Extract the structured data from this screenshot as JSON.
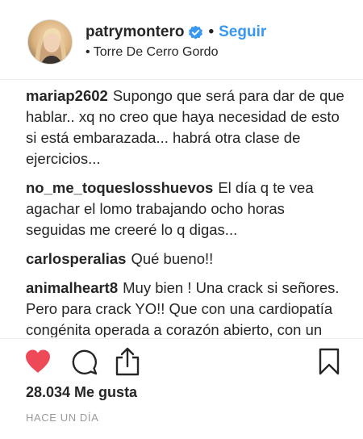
{
  "post": {
    "username": "patrymontero",
    "separator": "•",
    "follow_label": "Seguir",
    "location": "• Torre De Cerro Gordo",
    "verified_icon": "verified-badge-icon",
    "accent_color": "#3897f0",
    "heart_color": "#ed4956"
  },
  "comments": [
    {
      "user": "mariap2602",
      "text": "Supongo que será para dar de que hablar.. xq no creo que haya necesidad de esto si está embarazada... habrá otra clase de ejercicios..."
    },
    {
      "user": "no_me_toqueslosshuevos",
      "text": "El día q te vea agachar el lomo trabajando ocho horas seguidas me creeré lo q digas..."
    },
    {
      "user": "carlosperalias",
      "text": "Qué bueno!!"
    },
    {
      "user": "animalheart8",
      "text": "Muy bien ! Una crack si señores. Pero para crack YO!! Que con una cardiopatía congénita operada a corazón abierto, con un Dai implantado"
    }
  ],
  "actions": {
    "like_icon": "heart-filled-icon",
    "comment_icon": "comment-icon",
    "share_icon": "share-icon",
    "save_icon": "bookmark-icon"
  },
  "likes_text": "28.034 Me gusta",
  "timestamp": "HACE UN DÍA"
}
